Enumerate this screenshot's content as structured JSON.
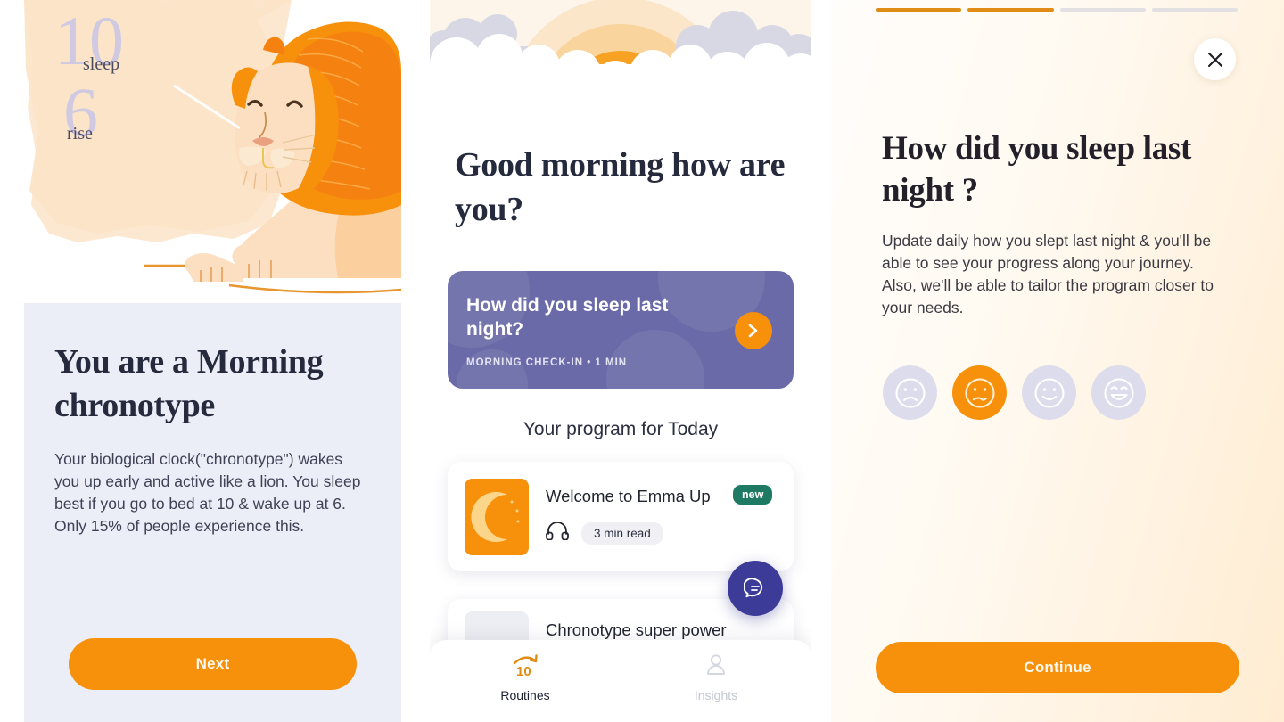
{
  "panel1": {
    "illustration": {
      "name": "lion-chronotype-illustration",
      "sleep_hour": "10",
      "sleep_label": "sleep",
      "rise_hour": "6",
      "rise_label": "rise"
    },
    "title": "You are a Morning chronotype",
    "body": "Your biological clock(\"chronotype\") wakes you up early and active like a lion. You sleep best if you go to bed at 10 & wake up at 6. Only 15% of people experience this.",
    "next_label": "Next"
  },
  "panel2": {
    "illustration": "sunrise-clouds-illustration",
    "greeting": "Good morning how are you?",
    "checkin": {
      "title": "How did you sleep last night?",
      "meta": "MORNING CHECK-IN • 1 MIN",
      "arrow_icon": "chevron-right-icon"
    },
    "section_title": "Your program for Today",
    "cards": [
      {
        "title": "Welcome to Emma Up",
        "badge": "new",
        "media_icon": "headphones-icon",
        "duration": "3 min read",
        "thumb_icon": "moon-clock-icon"
      },
      {
        "title": "Chronotype super power",
        "badge": "",
        "media_icon": "",
        "duration": "",
        "thumb_icon": "placeholder-thumbnail"
      }
    ],
    "fab_icon": "chat-bubble-icon",
    "nav": [
      {
        "label": "Routines",
        "icon": "routines-10-arrow-icon",
        "active": true
      },
      {
        "label": "Insights",
        "icon": "person-icon",
        "active": false
      }
    ]
  },
  "panel3": {
    "progress": {
      "total": 4,
      "filled": 2
    },
    "close_icon": "close-icon",
    "title": "How did you sleep last night ?",
    "body": "Update daily how you slept last night & you'll be able to see your progress along your journey. Also, we'll be able to tailor the program closer to your needs.",
    "faces": [
      {
        "name": "face-sad",
        "selected": false
      },
      {
        "name": "face-confused",
        "selected": true
      },
      {
        "name": "face-smile",
        "selected": false
      },
      {
        "name": "face-grin",
        "selected": false
      }
    ],
    "continue_label": "Continue"
  },
  "colors": {
    "accent_orange": "#f7900b",
    "card_purple": "#6a6aa8",
    "fab_purple": "#3c3b98",
    "badge_green": "#1f7a63",
    "lavender_bg": "#eceef7",
    "ink": "#262a3d"
  }
}
